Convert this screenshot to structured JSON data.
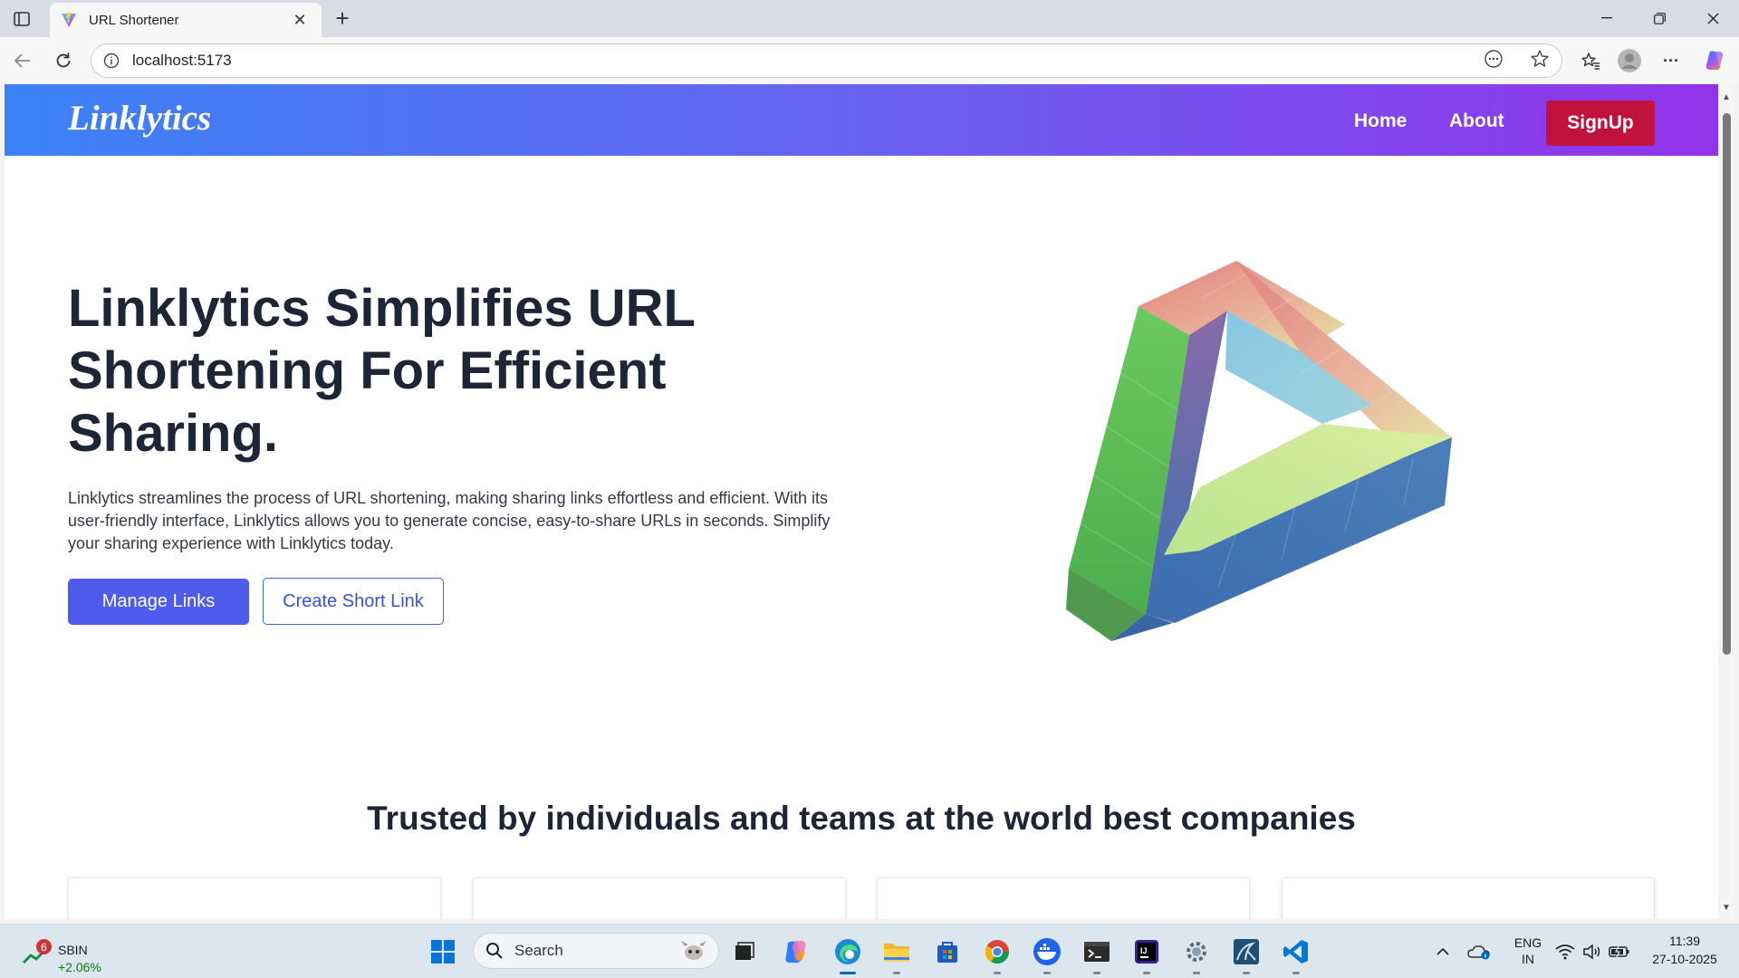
{
  "browser": {
    "tab_title": "URL Shortener",
    "close_glyph": "✕",
    "new_tab_glyph": "+",
    "url": "localhost:5173",
    "minimize_glyph": "─",
    "restore_glyph": "❐",
    "window_close_glyph": "✕",
    "more_glyph": "···"
  },
  "site": {
    "logo": "Linklytics",
    "nav": {
      "home": "Home",
      "about": "About",
      "signup": "SignUp"
    },
    "hero": {
      "title": "Linklytics Simplifies URL Shortening For Efficient Sharing.",
      "description": "Linklytics streamlines the process of URL shortening, making sharing links effortless and efficient. With its user-friendly interface, Linklytics allows you to generate concise, easy-to-share URLs in seconds. Simplify your sharing experience with Linklytics today.",
      "primary_button": "Manage Links",
      "secondary_button": "Create Short Link"
    },
    "trusted_heading": "Trusted by individuals and teams at the world best companies",
    "colors": {
      "nav_gradient_start": "#3b82f6",
      "nav_gradient_end": "#9333ea",
      "signup": "#c1123d",
      "primary_button": "#4f5bec",
      "heading": "#1e2536"
    }
  },
  "taskbar": {
    "stock_name": "SBIN",
    "stock_change": "+2.06%",
    "stock_badge": "6",
    "search_label": "Search",
    "language_line1": "ENG",
    "language_line2": "IN",
    "time": "11:39",
    "date": "27-10-2025",
    "icons": [
      "windows-start-icon",
      "search-icon",
      "task-view-icon",
      "copilot-icon",
      "edge-icon",
      "file-explorer-icon",
      "store-icon",
      "chrome-icon",
      "docker-icon",
      "terminal-icon",
      "intellij-icon",
      "settings-icon",
      "mysql-workbench-icon",
      "vscode-icon"
    ]
  }
}
